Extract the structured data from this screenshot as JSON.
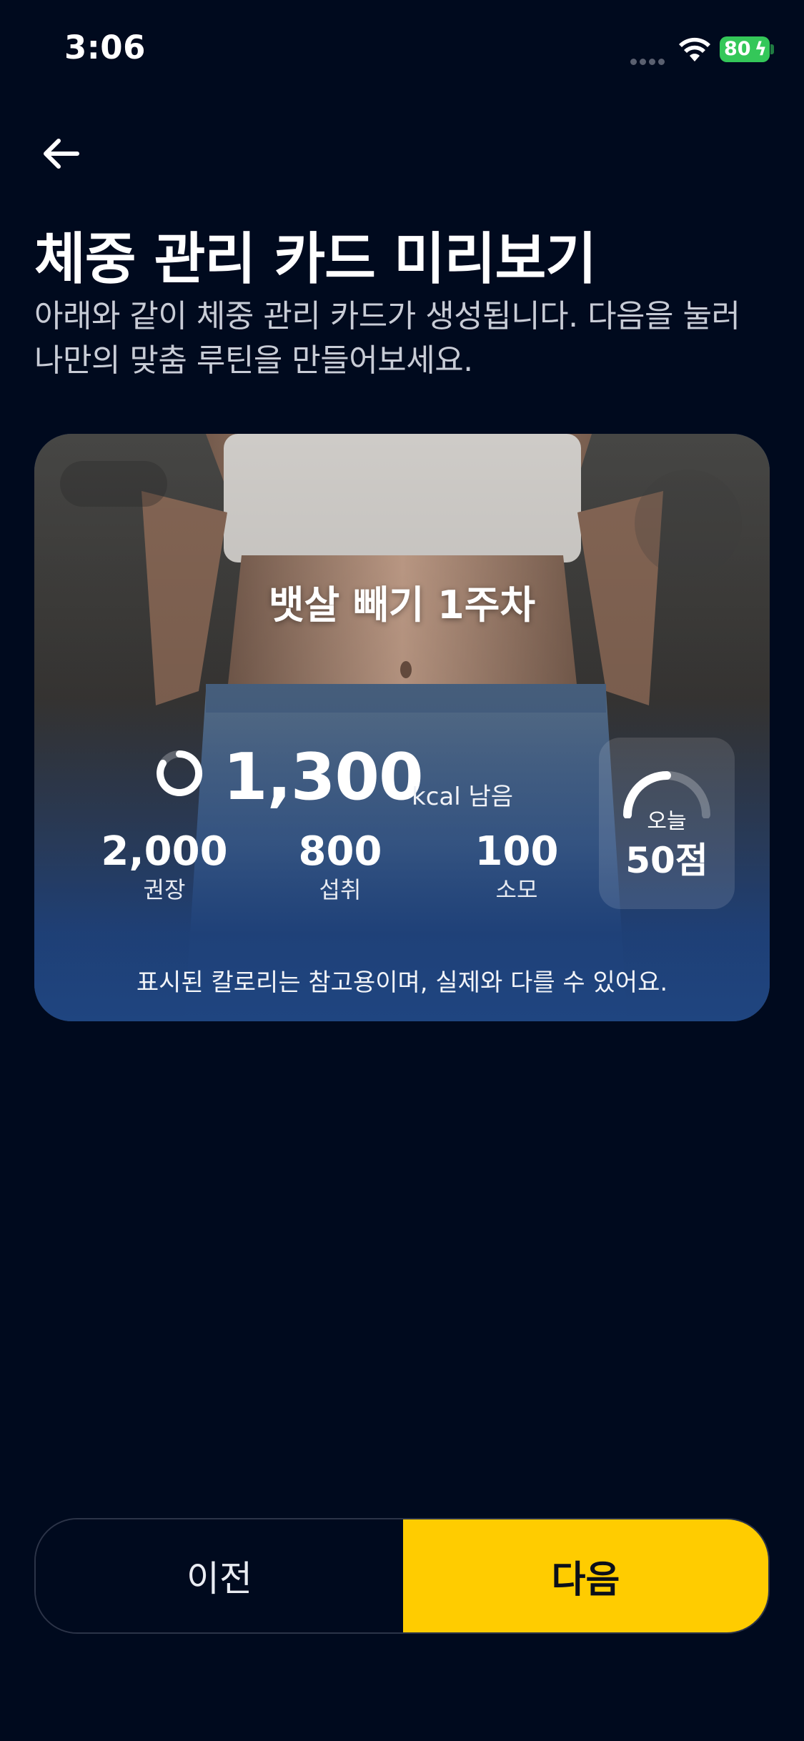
{
  "status_bar": {
    "time": "3:06",
    "battery": "80",
    "icons": [
      "signal-dots-icon",
      "wifi-icon",
      "battery-charging-icon"
    ]
  },
  "header": {
    "back_icon": "arrow-left-icon",
    "title": "체중 관리 카드 미리보기",
    "subtitle": "아래와 같이 체중 관리 카드가 생성됩니다. 다음을 눌러 나만의 맞춤 루틴을 만들어보세요."
  },
  "card": {
    "title": "뱃살 빼기 1주차",
    "calories_remaining": "1,300",
    "calories_unit": "kcal 남음",
    "stats": [
      {
        "value": "2,000",
        "label": "권장"
      },
      {
        "value": "800",
        "label": "섭취"
      },
      {
        "value": "100",
        "label": "소모"
      }
    ],
    "score": {
      "label": "오늘",
      "value": "50점",
      "fraction": 0.5
    },
    "disclaimer": "표시된 칼로리는 참고용이며, 실제와 다를 수 있어요.",
    "colors": {
      "card_bottom": "#1f4580",
      "accent": "#ffcc00"
    }
  },
  "buttons": {
    "prev_label": "이전",
    "next_label": "다음"
  }
}
